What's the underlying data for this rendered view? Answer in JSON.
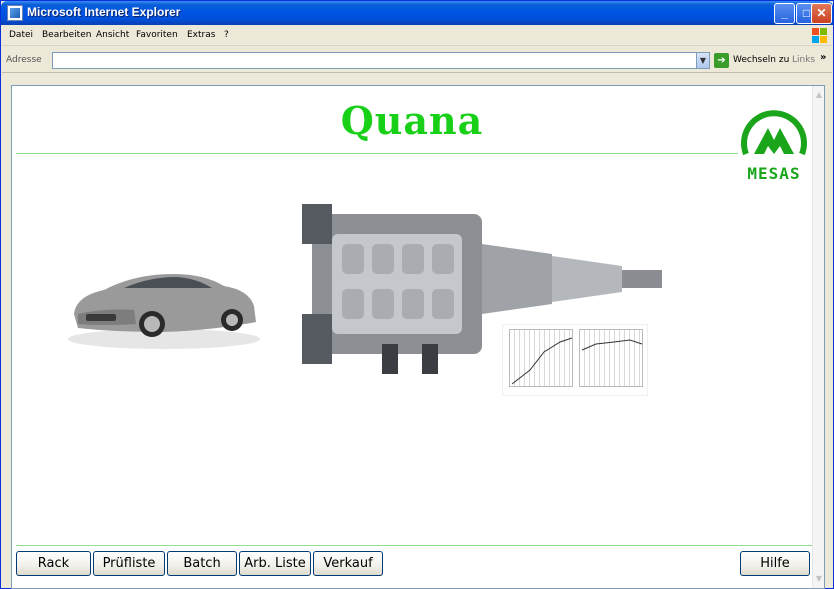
{
  "window": {
    "title": "Microsoft Internet Explorer",
    "controls": {
      "minimize": "_",
      "maximize": "□",
      "close": "✕"
    }
  },
  "menubar": {
    "items": [
      "Datei",
      "Bearbeiten",
      "Ansicht",
      "Favoriten",
      "Extras",
      "?"
    ]
  },
  "addressbar": {
    "label": "Adresse",
    "value": "",
    "go_label": "Wechseln zu",
    "links_label": "Links",
    "links_chevron": "»"
  },
  "page": {
    "title": "Quana",
    "logo_text": "MESAS",
    "colors": {
      "title": "#19d019",
      "rule": "#8ee08e",
      "logo": "#1aa51a"
    }
  },
  "buttons": {
    "rack": "Rack",
    "pruefliste": "Prüfliste",
    "batch": "Batch",
    "arb_liste": "Arb. Liste",
    "verkauf": "Verkauf",
    "hilfe": "Hilfe"
  }
}
